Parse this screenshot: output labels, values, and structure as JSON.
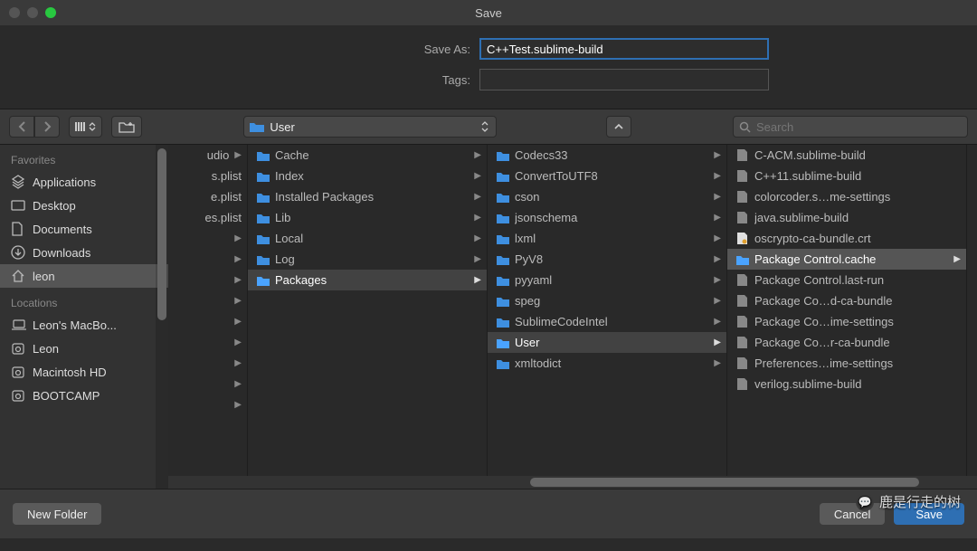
{
  "window": {
    "title": "Save"
  },
  "form": {
    "saveas_label": "Save As:",
    "saveas_value": "C++Test.sublime-build",
    "tags_label": "Tags:",
    "tags_value": ""
  },
  "toolbar": {
    "location": "User",
    "search_placeholder": "Search"
  },
  "sidebar": {
    "favorites_label": "Favorites",
    "favorites": [
      {
        "icon": "app",
        "label": "Applications"
      },
      {
        "icon": "desk",
        "label": "Desktop"
      },
      {
        "icon": "doc",
        "label": "Documents"
      },
      {
        "icon": "down",
        "label": "Downloads"
      },
      {
        "icon": "home",
        "label": "leon",
        "selected": true
      }
    ],
    "locations_label": "Locations",
    "locations": [
      {
        "icon": "laptop",
        "label": "Leon's MacBo..."
      },
      {
        "icon": "disk",
        "label": "Leon"
      },
      {
        "icon": "disk",
        "label": "Macintosh HD"
      },
      {
        "icon": "disk",
        "label": "BOOTCAMP"
      }
    ]
  },
  "columns": [
    {
      "narrow": true,
      "items": [
        {
          "type": "folder",
          "name": "udio"
        },
        {
          "type": "file",
          "name": "s.plist"
        },
        {
          "type": "file",
          "name": "e.plist"
        },
        {
          "type": "file",
          "name": "es.plist"
        },
        {
          "type": "blank"
        },
        {
          "type": "blank"
        },
        {
          "type": "blank"
        },
        {
          "type": "blank"
        },
        {
          "type": "blank"
        },
        {
          "type": "blank"
        },
        {
          "type": "blank"
        },
        {
          "type": "blank"
        },
        {
          "type": "blank"
        }
      ]
    },
    {
      "items": [
        {
          "type": "folder",
          "name": "Cache"
        },
        {
          "type": "folder",
          "name": "Index"
        },
        {
          "type": "folder",
          "name": "Installed Packages"
        },
        {
          "type": "folder",
          "name": "Lib"
        },
        {
          "type": "folder",
          "name": "Local"
        },
        {
          "type": "folder",
          "name": "Log"
        },
        {
          "type": "folder",
          "name": "Packages",
          "selected": true
        }
      ]
    },
    {
      "items": [
        {
          "type": "folder",
          "name": "Codecs33"
        },
        {
          "type": "folder",
          "name": "ConvertToUTF8"
        },
        {
          "type": "folder",
          "name": "cson"
        },
        {
          "type": "folder",
          "name": "jsonschema"
        },
        {
          "type": "folder",
          "name": "lxml"
        },
        {
          "type": "folder",
          "name": "PyV8"
        },
        {
          "type": "folder",
          "name": "pyyaml"
        },
        {
          "type": "folder",
          "name": "speg"
        },
        {
          "type": "folder",
          "name": "SublimeCodeIntel"
        },
        {
          "type": "folder",
          "name": "User",
          "selected": true
        },
        {
          "type": "folder",
          "name": "xmltodict"
        }
      ]
    },
    {
      "items": [
        {
          "type": "file",
          "name": "C-ACM.sublime-build"
        },
        {
          "type": "file",
          "name": "C++11.sublime-build"
        },
        {
          "type": "file",
          "name": "colorcoder.s…me-settings"
        },
        {
          "type": "file",
          "name": "java.sublime-build"
        },
        {
          "type": "cert",
          "name": "oscrypto-ca-bundle.crt"
        },
        {
          "type": "folder",
          "name": "Package Control.cache",
          "selected": true
        },
        {
          "type": "file",
          "name": "Package Control.last-run"
        },
        {
          "type": "file",
          "name": "Package Co…d-ca-bundle"
        },
        {
          "type": "file",
          "name": "Package Co…ime-settings"
        },
        {
          "type": "file",
          "name": "Package Co…r-ca-bundle"
        },
        {
          "type": "file",
          "name": "Preferences…ime-settings"
        },
        {
          "type": "file",
          "name": "verilog.sublime-build"
        }
      ]
    }
  ],
  "footer": {
    "new_folder": "New Folder",
    "cancel": "Cancel",
    "save": "Save"
  },
  "watermark": "鹿是行走的树"
}
